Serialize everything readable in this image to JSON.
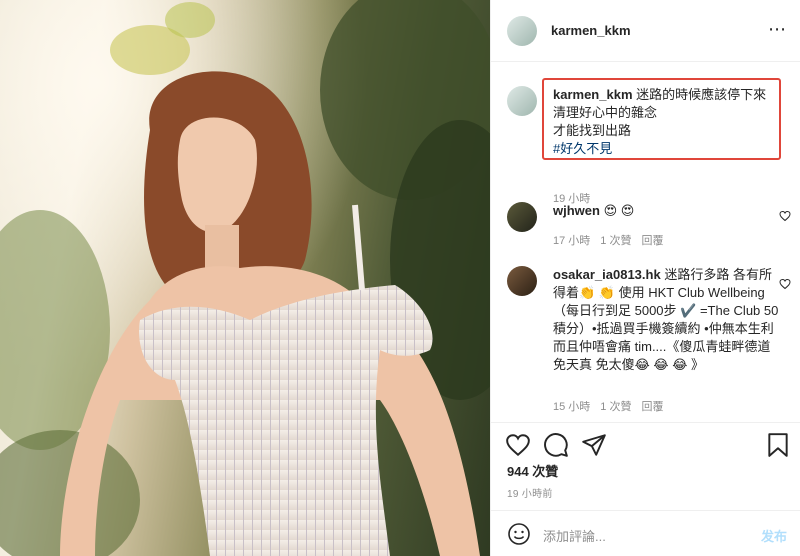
{
  "header": {
    "username": "karmen_kkm",
    "more_icon": "⋯"
  },
  "caption": {
    "username": "karmen_kkm",
    "lines": [
      "迷路的時候應該停下來",
      "清理好心中的雜念",
      "才能找到出路"
    ],
    "hashtag": "#好久不見",
    "time": "19 小時"
  },
  "comments": [
    {
      "username": "wjhwen",
      "text": "😍 😍",
      "time": "17 小時",
      "likes": "1 次贊",
      "reply": "回覆"
    },
    {
      "username": "osakar_ia0813.hk",
      "text": "迷路行多路 各有所得着👏 👏 使用 HKT Club Wellbeing （每日行到足 5000步 ✔️ =The Club 50積分）•抵過買手機簽續約 •仲無本生利 而且仲唔會痛 tim....《傻瓜青蛙畔德道 免天真 免太傻😂 😂 😂 》",
      "time": "15 小時",
      "likes": "1 次贊",
      "reply": "回覆"
    }
  ],
  "actions": {
    "likes": "944 次贊",
    "time": "19 小時前"
  },
  "add_comment": {
    "placeholder": "添加評論...",
    "post_label": "发布"
  },
  "colors": {
    "highlight": "#e0463a",
    "link": "#00376b",
    "post_disabled": "#b2dffc"
  },
  "icons": [
    "heart-icon",
    "comment-icon",
    "share-icon",
    "bookmark-icon",
    "emoji-icon",
    "more-icon"
  ]
}
